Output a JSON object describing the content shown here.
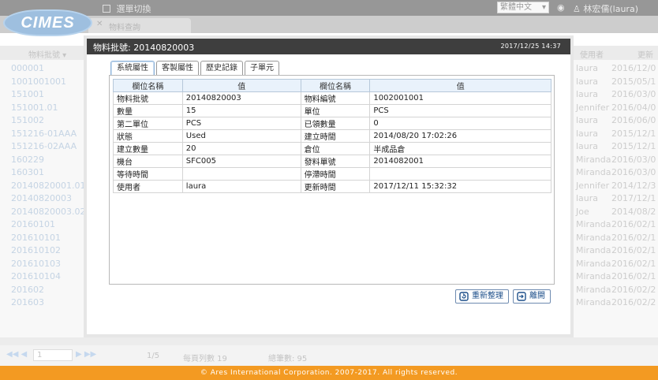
{
  "app": {
    "logo_text": "CIMES",
    "menu_label": "選單切換",
    "language": "繁體中文",
    "user": "林宏儒(laura)",
    "open_tab": "物料查詢"
  },
  "background_table": {
    "header": {
      "col_lot": "物料批號 ▾",
      "col_user": "使用者",
      "col_update": "更新"
    },
    "rows": [
      {
        "lot": "000001",
        "user": "laura",
        "date": "2016/12/0"
      },
      {
        "lot": "1001001001",
        "user": "laura",
        "date": "2015/05/1"
      },
      {
        "lot": "151001",
        "user": "laura",
        "date": "2016/03/0"
      },
      {
        "lot": "151001.01",
        "user": "Jennifer",
        "date": "2016/04/0"
      },
      {
        "lot": "151002",
        "user": "laura",
        "date": "2016/06/0"
      },
      {
        "lot": "151216-01AAA",
        "user": "laura",
        "date": "2015/12/1"
      },
      {
        "lot": "151216-02AAA",
        "user": "laura",
        "date": "2015/12/1"
      },
      {
        "lot": "160229",
        "user": "Miranda",
        "date": "2016/03/0"
      },
      {
        "lot": "160301",
        "user": "Miranda",
        "date": "2016/03/0"
      },
      {
        "lot": "20140820001.01",
        "user": "Jennifer",
        "date": "2014/12/3"
      },
      {
        "lot": "20140820003",
        "user": "laura",
        "date": "2017/12/1"
      },
      {
        "lot": "20140820003.02",
        "user": "Joe",
        "date": "2014/08/2"
      },
      {
        "lot": "20160101",
        "user": "Miranda",
        "date": "2016/02/1"
      },
      {
        "lot": "201610101",
        "user": "Miranda",
        "date": "2016/02/1"
      },
      {
        "lot": "201610102",
        "user": "Miranda",
        "date": "2016/02/1"
      },
      {
        "lot": "201610103",
        "user": "Miranda",
        "date": "2016/02/1"
      },
      {
        "lot": "201610104",
        "user": "Miranda",
        "date": "2016/02/1"
      },
      {
        "lot": "201602",
        "user": "Miranda",
        "date": "2016/02/2"
      },
      {
        "lot": "201603",
        "user": "Miranda",
        "date": "2016/02/2"
      }
    ]
  },
  "pager": {
    "page": "1",
    "page_count": "1/5",
    "per_page": "每頁列數 19",
    "total": "總筆數: 95"
  },
  "dialog": {
    "title": "物料批號: 20140820003",
    "datetime": "2017/12/25 14:37",
    "tabs": [
      "系統屬性",
      "客製屬性",
      "歷史記錄",
      "子單元"
    ],
    "active_tab": 0,
    "table": {
      "headers": [
        "欄位名稱",
        "值",
        "欄位名稱",
        "值"
      ],
      "rows": [
        [
          "物料批號",
          "20140820003",
          "物料編號",
          "1002001001"
        ],
        [
          "數量",
          "15",
          "單位",
          "PCS"
        ],
        [
          "第二單位",
          "PCS",
          "已領數量",
          "0"
        ],
        [
          "狀態",
          "Used",
          "建立時間",
          "2014/08/20 17:02:26"
        ],
        [
          "建立數量",
          "20",
          "倉位",
          "半成品倉"
        ],
        [
          "機台",
          "SFC005",
          "發料單號",
          "2014082001"
        ],
        [
          "等待時間",
          "",
          "停滯時間",
          ""
        ],
        [
          "使用者",
          "laura",
          "更新時間",
          "2017/12/11 15:32:32"
        ]
      ]
    },
    "buttons": {
      "refresh": "重新整理",
      "leave": "離開"
    }
  },
  "footer": {
    "copyright": "© Ares International Corporation. 2007-2017. All rights reserved."
  },
  "colors": {
    "footer_bg": "#f39a22",
    "title_bar": "#3e3e3e",
    "header_bg": "#e9f2fb",
    "accent_blue": "#1d4f8a"
  }
}
